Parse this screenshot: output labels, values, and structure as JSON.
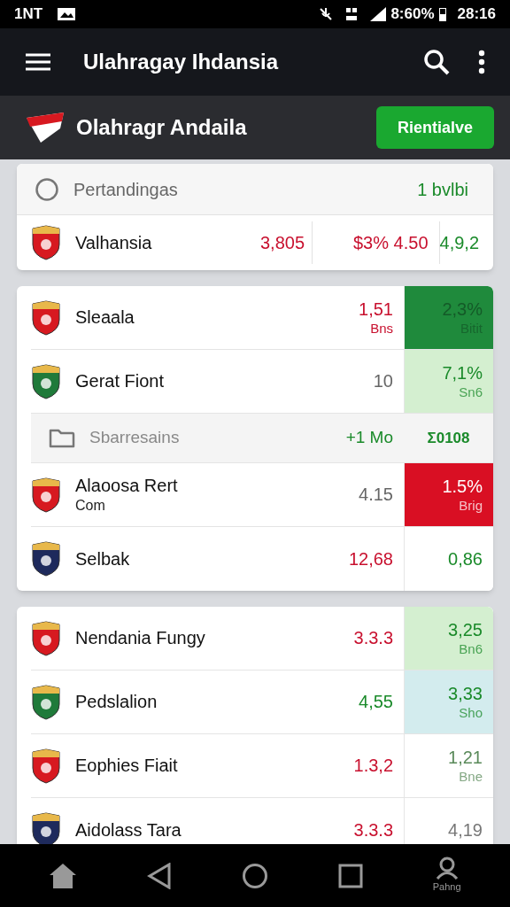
{
  "status_bar": {
    "left_text": "1NT",
    "battery": "8:60%",
    "time": "28:16"
  },
  "app_bar": {
    "title": "Ulahragay Ihdansia"
  },
  "header": {
    "title": "Olahragr Andaila",
    "button": "Rientialve"
  },
  "summary_card": {
    "label": "Pertandingas",
    "count": "1 bvlbi",
    "row": {
      "name": "Valhansia",
      "crest": {
        "color": "#d71920"
      },
      "cells": [
        {
          "text": "3,805",
          "color": "#c8102e"
        },
        {
          "text": "$3% 4.50",
          "color": "#c8102e"
        },
        {
          "text": "4,9,2",
          "color": "#1a8a2a"
        }
      ]
    }
  },
  "cards": [
    {
      "rows": [
        {
          "kind": "team",
          "name": "Sleaala",
          "crest": {
            "color": "#d71920"
          },
          "value": {
            "text": "1,51",
            "sub": "Bns",
            "color": "#c8102e"
          },
          "odds": {
            "text": "2,3%",
            "sub": "Bitit",
            "color": "#145a28"
          },
          "odds_fill": {
            "color": "#1f8a3c"
          }
        },
        {
          "kind": "team",
          "name": "Gerat Fiont",
          "crest": {
            "color": "#1f7a3a"
          },
          "value": {
            "text": "10",
            "color": "#666666"
          },
          "odds": {
            "text": "7,1%",
            "sub": "Sn6",
            "color": "#1a8a2a"
          },
          "odds_fill": {
            "color": "#d4efd0"
          }
        },
        {
          "kind": "section",
          "name": "Sbarresains",
          "value": {
            "text": "+1 Mo"
          },
          "odds": {
            "text": "Σ0108"
          }
        },
        {
          "kind": "team",
          "name": "Alaoosa Rert",
          "sub": "Com",
          "crest": {
            "color": "#d71920"
          },
          "value": {
            "text": "4.15",
            "color": "#666666"
          },
          "odds": {
            "text": "1.5%",
            "sub": "Brig",
            "color": "#ffffff"
          },
          "odds_fill": {
            "color": "#d90f23"
          }
        },
        {
          "kind": "team",
          "name": "Selbak",
          "crest": {
            "color": "#1e2a5c"
          },
          "value": {
            "text": "12,68",
            "color": "#c8102e"
          },
          "odds": {
            "text": "0,86",
            "color": "#1a8a2a"
          },
          "odds_fill": {
            "color": "#ffffff"
          }
        }
      ]
    },
    {
      "rows": [
        {
          "kind": "team",
          "name": "Nendania Fungy",
          "crest": {
            "color": "#d71920"
          },
          "value": {
            "text": "3.3.3",
            "color": "#c8102e"
          },
          "odds": {
            "text": "3,25",
            "sub": "Bn6",
            "color": "#1a8a2a"
          },
          "odds_fill": {
            "color": "#d4efd0"
          }
        },
        {
          "kind": "team",
          "name": "Pedslalion",
          "crest": {
            "color": "#1f7a3a"
          },
          "value": {
            "text": "4,55",
            "color": "#1a8a2a"
          },
          "odds": {
            "text": "3,33",
            "sub": "Sho",
            "color": "#1a8a2a"
          },
          "odds_fill": {
            "color": "#d3ecee"
          }
        },
        {
          "kind": "team",
          "name": "Eophies Fiait",
          "crest": {
            "color": "#d71920"
          },
          "value": {
            "text": "1.3,2",
            "color": "#c8102e"
          },
          "odds": {
            "text": "1,21",
            "sub": "Bne",
            "color": "#5a8a5a"
          },
          "odds_fill": {
            "color": "#ffffff"
          }
        },
        {
          "kind": "team",
          "name": "Aidolass Tara",
          "crest": {
            "color": "#1e2a5c"
          },
          "value": {
            "text": "3.3.3",
            "color": "#c8102e"
          },
          "odds": {
            "text": "4,19",
            "color": "#777777"
          },
          "odds_fill": {
            "color": "#ffffff"
          }
        }
      ]
    }
  ],
  "nav_bar": {
    "profile_label": "Pahng"
  }
}
